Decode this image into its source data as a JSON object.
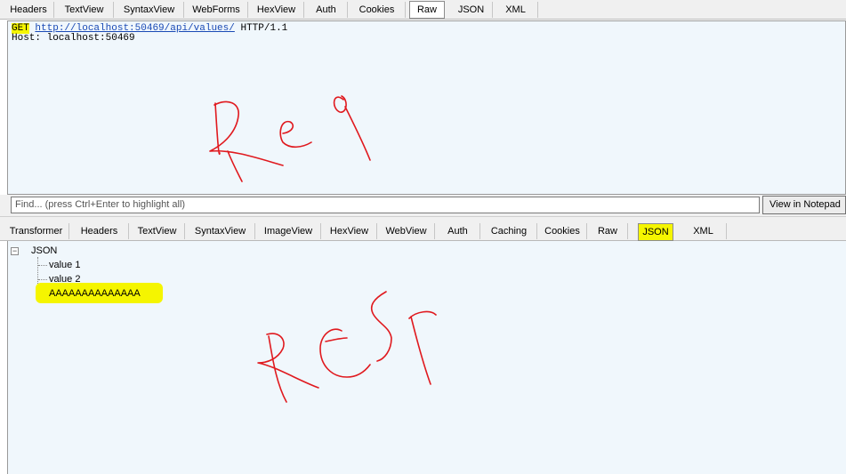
{
  "request_tabs": [
    {
      "label": "Headers",
      "selected": false
    },
    {
      "label": "TextView",
      "selected": false
    },
    {
      "label": "SyntaxView",
      "selected": false
    },
    {
      "label": "WebForms",
      "selected": false
    },
    {
      "label": "HexView",
      "selected": false
    },
    {
      "label": "Auth",
      "selected": false
    },
    {
      "label": "Cookies",
      "selected": false
    },
    {
      "label": "Raw",
      "selected": true
    },
    {
      "label": "JSON",
      "selected": false
    },
    {
      "label": "XML",
      "selected": false
    }
  ],
  "raw_request": {
    "method": "GET",
    "url": "http://localhost:50469/api/values/",
    "protocol": "HTTP/1.1",
    "host_line": "Host: localhost:50469"
  },
  "find": {
    "placeholder": "Find... (press Ctrl+Enter to highlight all)",
    "notepad_button": "View in Notepad"
  },
  "response_tabs": [
    {
      "label": "Transformer",
      "selected": false
    },
    {
      "label": "Headers",
      "selected": false
    },
    {
      "label": "TextView",
      "selected": false
    },
    {
      "label": "SyntaxView",
      "selected": false
    },
    {
      "label": "ImageView",
      "selected": false
    },
    {
      "label": "HexView",
      "selected": false
    },
    {
      "label": "WebView",
      "selected": false
    },
    {
      "label": "Auth",
      "selected": false
    },
    {
      "label": "Caching",
      "selected": false
    },
    {
      "label": "Cookies",
      "selected": false
    },
    {
      "label": "Raw",
      "selected": false
    },
    {
      "label": "JSON",
      "selected": true
    },
    {
      "label": "XML",
      "selected": false
    }
  ],
  "json_tree": {
    "root": "JSON",
    "expander": "−",
    "items": [
      "value 1",
      "value 2",
      "AAAAAAAAAAAAAA"
    ]
  },
  "annotations": {
    "highlight_color": "#f5f500",
    "ink_color": "#e0191e"
  }
}
